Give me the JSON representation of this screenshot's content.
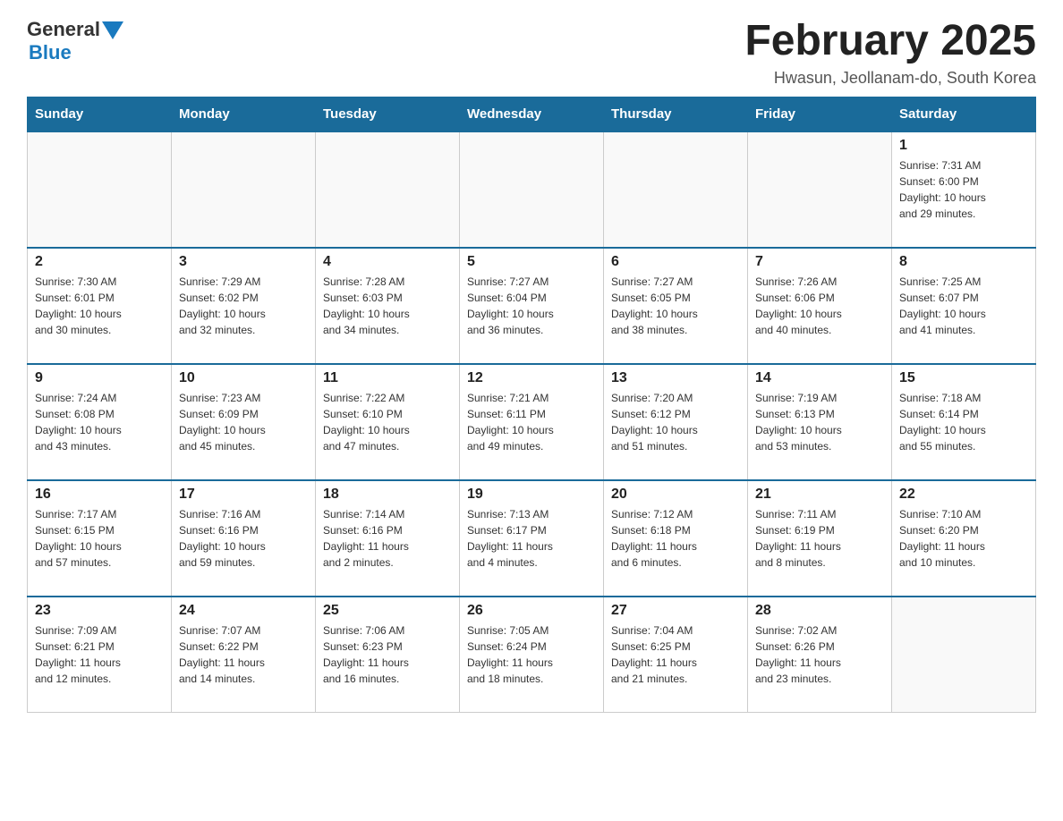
{
  "header": {
    "logo": {
      "general": "General",
      "blue": "Blue"
    },
    "title": "February 2025",
    "subtitle": "Hwasun, Jeollanam-do, South Korea"
  },
  "days_of_week": [
    "Sunday",
    "Monday",
    "Tuesday",
    "Wednesday",
    "Thursday",
    "Friday",
    "Saturday"
  ],
  "weeks": [
    [
      {
        "day": "",
        "info": ""
      },
      {
        "day": "",
        "info": ""
      },
      {
        "day": "",
        "info": ""
      },
      {
        "day": "",
        "info": ""
      },
      {
        "day": "",
        "info": ""
      },
      {
        "day": "",
        "info": ""
      },
      {
        "day": "1",
        "info": "Sunrise: 7:31 AM\nSunset: 6:00 PM\nDaylight: 10 hours\nand 29 minutes."
      }
    ],
    [
      {
        "day": "2",
        "info": "Sunrise: 7:30 AM\nSunset: 6:01 PM\nDaylight: 10 hours\nand 30 minutes."
      },
      {
        "day": "3",
        "info": "Sunrise: 7:29 AM\nSunset: 6:02 PM\nDaylight: 10 hours\nand 32 minutes."
      },
      {
        "day": "4",
        "info": "Sunrise: 7:28 AM\nSunset: 6:03 PM\nDaylight: 10 hours\nand 34 minutes."
      },
      {
        "day": "5",
        "info": "Sunrise: 7:27 AM\nSunset: 6:04 PM\nDaylight: 10 hours\nand 36 minutes."
      },
      {
        "day": "6",
        "info": "Sunrise: 7:27 AM\nSunset: 6:05 PM\nDaylight: 10 hours\nand 38 minutes."
      },
      {
        "day": "7",
        "info": "Sunrise: 7:26 AM\nSunset: 6:06 PM\nDaylight: 10 hours\nand 40 minutes."
      },
      {
        "day": "8",
        "info": "Sunrise: 7:25 AM\nSunset: 6:07 PM\nDaylight: 10 hours\nand 41 minutes."
      }
    ],
    [
      {
        "day": "9",
        "info": "Sunrise: 7:24 AM\nSunset: 6:08 PM\nDaylight: 10 hours\nand 43 minutes."
      },
      {
        "day": "10",
        "info": "Sunrise: 7:23 AM\nSunset: 6:09 PM\nDaylight: 10 hours\nand 45 minutes."
      },
      {
        "day": "11",
        "info": "Sunrise: 7:22 AM\nSunset: 6:10 PM\nDaylight: 10 hours\nand 47 minutes."
      },
      {
        "day": "12",
        "info": "Sunrise: 7:21 AM\nSunset: 6:11 PM\nDaylight: 10 hours\nand 49 minutes."
      },
      {
        "day": "13",
        "info": "Sunrise: 7:20 AM\nSunset: 6:12 PM\nDaylight: 10 hours\nand 51 minutes."
      },
      {
        "day": "14",
        "info": "Sunrise: 7:19 AM\nSunset: 6:13 PM\nDaylight: 10 hours\nand 53 minutes."
      },
      {
        "day": "15",
        "info": "Sunrise: 7:18 AM\nSunset: 6:14 PM\nDaylight: 10 hours\nand 55 minutes."
      }
    ],
    [
      {
        "day": "16",
        "info": "Sunrise: 7:17 AM\nSunset: 6:15 PM\nDaylight: 10 hours\nand 57 minutes."
      },
      {
        "day": "17",
        "info": "Sunrise: 7:16 AM\nSunset: 6:16 PM\nDaylight: 10 hours\nand 59 minutes."
      },
      {
        "day": "18",
        "info": "Sunrise: 7:14 AM\nSunset: 6:16 PM\nDaylight: 11 hours\nand 2 minutes."
      },
      {
        "day": "19",
        "info": "Sunrise: 7:13 AM\nSunset: 6:17 PM\nDaylight: 11 hours\nand 4 minutes."
      },
      {
        "day": "20",
        "info": "Sunrise: 7:12 AM\nSunset: 6:18 PM\nDaylight: 11 hours\nand 6 minutes."
      },
      {
        "day": "21",
        "info": "Sunrise: 7:11 AM\nSunset: 6:19 PM\nDaylight: 11 hours\nand 8 minutes."
      },
      {
        "day": "22",
        "info": "Sunrise: 7:10 AM\nSunset: 6:20 PM\nDaylight: 11 hours\nand 10 minutes."
      }
    ],
    [
      {
        "day": "23",
        "info": "Sunrise: 7:09 AM\nSunset: 6:21 PM\nDaylight: 11 hours\nand 12 minutes."
      },
      {
        "day": "24",
        "info": "Sunrise: 7:07 AM\nSunset: 6:22 PM\nDaylight: 11 hours\nand 14 minutes."
      },
      {
        "day": "25",
        "info": "Sunrise: 7:06 AM\nSunset: 6:23 PM\nDaylight: 11 hours\nand 16 minutes."
      },
      {
        "day": "26",
        "info": "Sunrise: 7:05 AM\nSunset: 6:24 PM\nDaylight: 11 hours\nand 18 minutes."
      },
      {
        "day": "27",
        "info": "Sunrise: 7:04 AM\nSunset: 6:25 PM\nDaylight: 11 hours\nand 21 minutes."
      },
      {
        "day": "28",
        "info": "Sunrise: 7:02 AM\nSunset: 6:26 PM\nDaylight: 11 hours\nand 23 minutes."
      },
      {
        "day": "",
        "info": ""
      }
    ]
  ]
}
